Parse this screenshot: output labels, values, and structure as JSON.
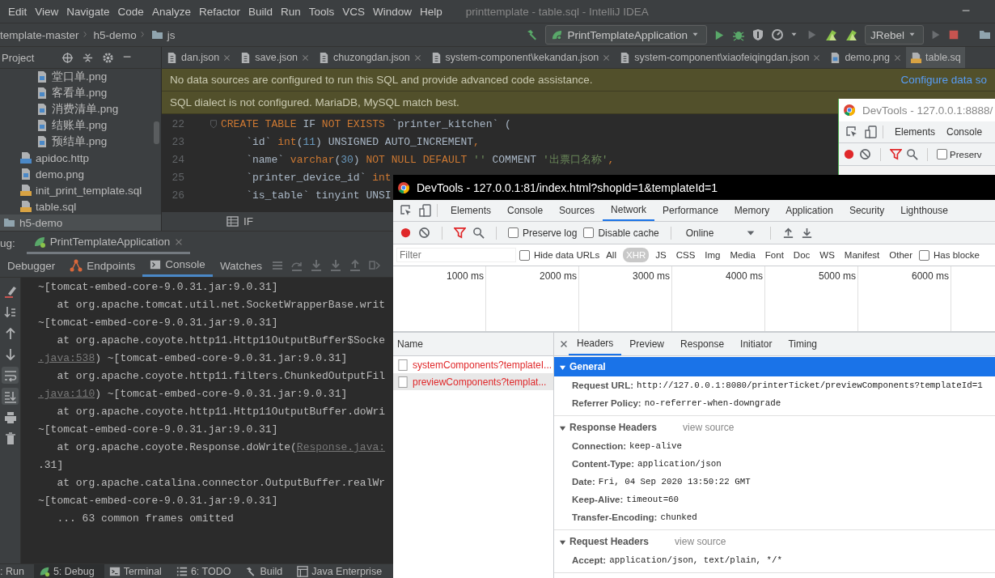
{
  "menu": [
    "Edit",
    "View",
    "Navigate",
    "Code",
    "Analyze",
    "Refactor",
    "Build",
    "Run",
    "Tools",
    "VCS",
    "Window",
    "Help"
  ],
  "window_title": "printtemplate - table.sql - IntelliJ IDEA",
  "breadcrumb": [
    {
      "label": "template-master",
      "kind": "module"
    },
    {
      "label": "h5-demo",
      "kind": "module"
    },
    {
      "label": "js",
      "kind": "folder"
    }
  ],
  "run_config": "PrintTemplateApplication",
  "jrebel": "JRebel",
  "project_header": "Project",
  "editor_tabs": [
    {
      "label": "dan.json",
      "kind": "json",
      "selected": false
    },
    {
      "label": "save.json",
      "kind": "json",
      "selected": false
    },
    {
      "label": "chuzongdan.json",
      "kind": "json",
      "selected": false
    },
    {
      "label": "system-component\\kekandan.json",
      "kind": "json",
      "selected": false
    },
    {
      "label": "system-component\\xiaofeiqingdan.json",
      "kind": "json",
      "selected": false
    },
    {
      "label": "demo.png",
      "kind": "image",
      "selected": false
    },
    {
      "label": "table.sq",
      "kind": "sql",
      "selected": true
    }
  ],
  "project_tree": [
    {
      "children": [
        {
          "children": [
            {
              "label": "堂口单.png",
              "kind": "image",
              "selected": false
            },
            {
              "label": "客看单.png",
              "kind": "image",
              "selected": false
            },
            {
              "label": "消费清单.png",
              "kind": "image",
              "selected": false
            },
            {
              "label": "结账单.png",
              "kind": "image",
              "selected": false
            },
            {
              "label": "预结单.png",
              "kind": "image",
              "selected": false
            }
          ]
        },
        {
          "label": "apidoc.http",
          "kind": "api",
          "selected": false
        },
        {
          "label": "demo.png",
          "kind": "image",
          "selected": false
        },
        {
          "label": "init_print_template.sql",
          "kind": "sql",
          "selected": false
        },
        {
          "label": "table.sql",
          "kind": "sql",
          "selected": false
        }
      ]
    },
    {
      "label": "h5-demo",
      "kind": "folder",
      "selected": true
    }
  ],
  "banners": [
    {
      "text": "No data sources are configured to run this SQL and provide advanced code assistance.",
      "link": "Configure data so"
    },
    {
      "text": "SQL dialect is not configured. MariaDB, MySQL match best."
    }
  ],
  "code_lines": [
    {
      "number": "22",
      "fold": true,
      "tokens": [
        {
          "text": "CREATE TABLE ",
          "kind": "keyword"
        },
        {
          "text": "IF ",
          "kind": "identifier"
        },
        {
          "text": "NOT EXISTS ",
          "kind": "keyword"
        },
        {
          "text": "`printer_kitchen` (",
          "kind": "identifier"
        }
      ]
    },
    {
      "number": "23",
      "fold": false,
      "tokens": [
        {
          "text": "    `id` ",
          "kind": "identifier"
        },
        {
          "text": "int",
          "kind": "keyword"
        },
        {
          "text": "(",
          "kind": "identifier"
        },
        {
          "text": "11",
          "kind": "number"
        },
        {
          "text": ") UNSIGNED AUTO_INCREMENT",
          "kind": "identifier"
        },
        {
          "text": ",",
          "kind": "keyword"
        }
      ]
    },
    {
      "number": "24",
      "fold": false,
      "tokens": [
        {
          "text": "    `name` ",
          "kind": "identifier"
        },
        {
          "text": "varchar",
          "kind": "keyword"
        },
        {
          "text": "(",
          "kind": "identifier"
        },
        {
          "text": "30",
          "kind": "number"
        },
        {
          "text": ") ",
          "kind": "identifier"
        },
        {
          "text": "NOT NULL DEFAULT ",
          "kind": "keyword"
        },
        {
          "text": "''",
          "kind": "string"
        },
        {
          "text": " COMMENT ",
          "kind": "identifier"
        },
        {
          "text": "'出票口名称'",
          "kind": "string"
        },
        {
          "text": ",",
          "kind": "keyword"
        }
      ]
    },
    {
      "number": "25",
      "fold": false,
      "tokens": [
        {
          "text": "    `printer_device_id` ",
          "kind": "identifier"
        },
        {
          "text": "int",
          "kind": "keyword"
        }
      ]
    },
    {
      "number": "26",
      "fold": false,
      "tokens": [
        {
          "text": "    `is_table` tinyint UNSI",
          "kind": "identifier"
        }
      ]
    }
  ],
  "structure_path": "IF",
  "debug": {
    "label": "ug:",
    "session": "PrintTemplateApplication",
    "tabs": [
      {
        "label": "Debugger",
        "kind": "plain",
        "selected": false
      },
      {
        "label": "Endpoints",
        "kind": "endpoints",
        "selected": false
      },
      {
        "label": "Console",
        "kind": "console",
        "selected": true
      },
      {
        "label": "Watches",
        "kind": "plain",
        "selected": false
      }
    ],
    "console": [
      [
        {
          "text": "~[tomcat-embed-core-9.0.31.jar:9.0.31]",
          "kind": "plain"
        }
      ],
      [
        {
          "text": "   at org.apache.tomcat.util.net.SocketWrapperBase.writ",
          "kind": "plain"
        }
      ],
      [
        {
          "text": "~[tomcat-embed-core-9.0.31.jar:9.0.31]",
          "kind": "plain"
        }
      ],
      [
        {
          "text": "   at org.apache.coyote.http11.Http11OutputBuffer$Socke",
          "kind": "plain"
        }
      ],
      [
        {
          "text": ".java:538",
          "kind": "link"
        },
        {
          "text": ") ~[tomcat-embed-core-9.0.31.jar:9.0.31]",
          "kind": "plain"
        }
      ],
      [
        {
          "text": "   at org.apache.coyote.http11.filters.ChunkedOutputFil",
          "kind": "plain"
        }
      ],
      [
        {
          "text": ".java:110",
          "kind": "link"
        },
        {
          "text": ") ~[tomcat-embed-core-9.0.31.jar:9.0.31]",
          "kind": "plain"
        }
      ],
      [
        {
          "text": "   at org.apache.coyote.http11.Http11OutputBuffer.doWri",
          "kind": "plain"
        }
      ],
      [
        {
          "text": "~[tomcat-embed-core-9.0.31.jar:9.0.31]",
          "kind": "plain"
        }
      ],
      [
        {
          "text": "   at org.apache.coyote.Response.doWrite(",
          "kind": "plain"
        },
        {
          "text": "Response.java:",
          "kind": "link"
        }
      ],
      [
        {
          "text": ".31]",
          "kind": "plain"
        }
      ],
      [
        {
          "text": "   at org.apache.catalina.connector.OutputBuffer.realWr",
          "kind": "plain"
        }
      ],
      [
        {
          "text": "~[tomcat-embed-core-9.0.31.jar:9.0.31]",
          "kind": "plain"
        }
      ],
      [
        {
          "text": "   ... 63 common frames omitted",
          "kind": "plain"
        }
      ]
    ]
  },
  "tool_windows": [
    {
      "label": ": Run",
      "kind": "run",
      "selected": false
    },
    {
      "label": "5: Debug",
      "kind": "debug",
      "selected": true
    },
    {
      "label": "Terminal",
      "kind": "terminal",
      "selected": false
    },
    {
      "label": "6: TODO",
      "kind": "todo",
      "selected": false
    },
    {
      "label": "Build",
      "kind": "build",
      "selected": false
    },
    {
      "label": "Java Enterprise",
      "kind": "enterprise",
      "selected": false
    }
  ],
  "devtools_back": {
    "title": "DevTools - 127.0.0.1:8888/",
    "tabs": [
      "Elements",
      "Console"
    ],
    "preserve": {
      "label": "Preserv",
      "checked": false
    }
  },
  "devtools": {
    "title": "DevTools - 127.0.0.1:81/index.html?shopId=1&templateId=1",
    "tabs": [
      {
        "label": "Elements",
        "selected": false
      },
      {
        "label": "Console",
        "selected": false
      },
      {
        "label": "Sources",
        "selected": false
      },
      {
        "label": "Network",
        "selected": true
      },
      {
        "label": "Performance",
        "selected": false
      },
      {
        "label": "Memory",
        "selected": false
      },
      {
        "label": "Application",
        "selected": false
      },
      {
        "label": "Security",
        "selected": false
      },
      {
        "label": "Lighthouse",
        "selected": false
      }
    ],
    "checks": [
      {
        "label": "Preserve log",
        "checked": false
      },
      {
        "label": "Disable cache",
        "checked": false
      }
    ],
    "throttle": "Online",
    "filter_placeholder": "Filter",
    "hide_data_urls": {
      "label": "Hide data URLs",
      "checked": false
    },
    "types": [
      {
        "label": "All",
        "selected": false
      },
      {
        "label": "XHR",
        "selected": true
      },
      {
        "label": "JS",
        "selected": false
      },
      {
        "label": "CSS",
        "selected": false
      },
      {
        "label": "Img",
        "selected": false
      },
      {
        "label": "Media",
        "selected": false
      },
      {
        "label": "Font",
        "selected": false
      },
      {
        "label": "Doc",
        "selected": false
      },
      {
        "label": "WS",
        "selected": false
      },
      {
        "label": "Manifest",
        "selected": false
      },
      {
        "label": "Other",
        "selected": false
      }
    ],
    "has_blocked": {
      "label": "Has blocke",
      "checked": false
    },
    "timeline": [
      "1000 ms",
      "2000 ms",
      "3000 ms",
      "4000 ms",
      "5000 ms",
      "6000 ms"
    ],
    "name_header": "Name",
    "requests": [
      {
        "label": "systemComponents?templateI...",
        "failed": true,
        "selected": false
      },
      {
        "label": "previewComponents?templat...",
        "failed": true,
        "selected": true
      }
    ],
    "detail_tabs": [
      {
        "label": "Headers",
        "selected": true
      },
      {
        "label": "Preview",
        "selected": false
      },
      {
        "label": "Response",
        "selected": false
      },
      {
        "label": "Initiator",
        "selected": false
      },
      {
        "label": "Timing",
        "selected": false
      }
    ],
    "sections": [
      {
        "title": "General",
        "selected": true,
        "expanded": true,
        "rows": [
          {
            "name": "Request URL:",
            "value": "http://127.0.0.1:8080/printerTicket/previewComponents?templateId=1"
          },
          {
            "name": "Referrer Policy:",
            "value": "no-referrer-when-downgrade"
          }
        ]
      },
      {
        "title": "Response Headers",
        "selected": false,
        "expanded": true,
        "view_source": "view source",
        "rows": [
          {
            "name": "Connection:",
            "value": "keep-alive"
          },
          {
            "name": "Content-Type:",
            "value": "application/json"
          },
          {
            "name": "Date:",
            "value": "Fri, 04 Sep 2020 13:50:22 GMT"
          },
          {
            "name": "Keep-Alive:",
            "value": "timeout=60"
          },
          {
            "name": "Transfer-Encoding:",
            "value": "chunked"
          }
        ]
      },
      {
        "title": "Request Headers",
        "selected": false,
        "expanded": true,
        "view_source": "view source",
        "rows": [
          {
            "name": "Accept:",
            "value": "application/json, text/plain, */*"
          }
        ]
      }
    ]
  }
}
